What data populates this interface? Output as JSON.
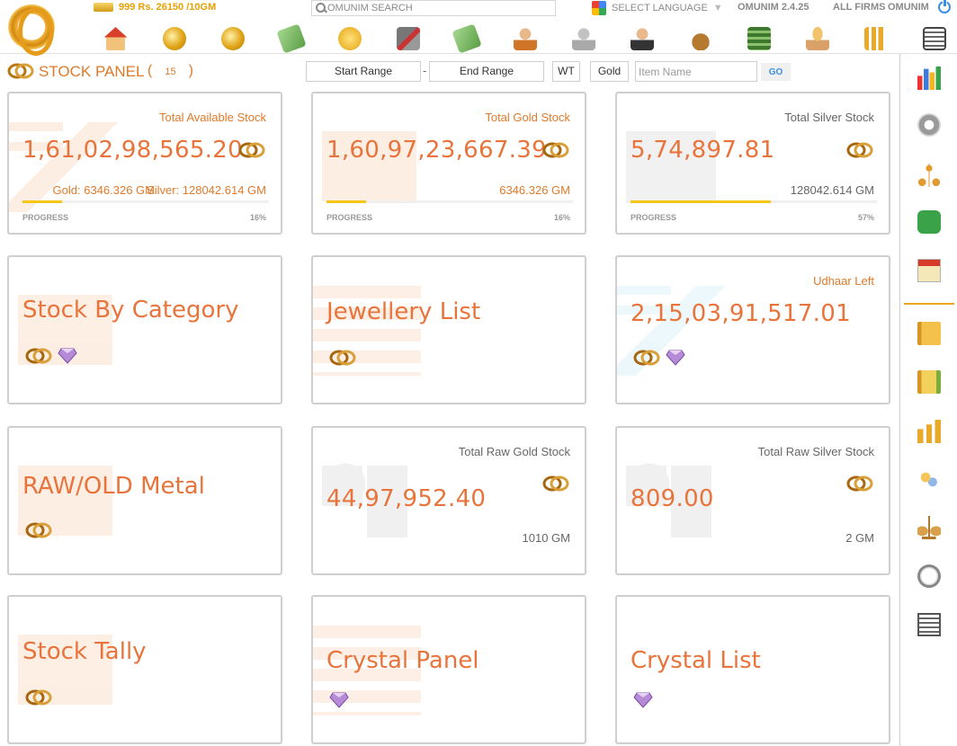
{
  "header": {
    "gold_rate": "999 Rs. 26150 /10GM",
    "search_placeholder": "OMUNIM SEARCH",
    "language": "SELECT LANGUAGE",
    "language_dropdown": "▼",
    "version": "OMUNIM 2.4.25",
    "firms": "ALL FIRMS",
    "user": "OMUNIM"
  },
  "toolbar": {
    "icons": [
      "home-icon",
      "coins-add-icon",
      "coins-icon",
      "money-hand-icon",
      "new-badge-icon",
      "hammer-icon",
      "cash-icon",
      "user-icon",
      "user-add-icon",
      "businessman-icon",
      "money-bag-icon",
      "banknotes-icon",
      "hand-coins-icon",
      "coin-stack-icon",
      "calculator-icon"
    ]
  },
  "sidebar": {
    "icons": [
      "stats-chart-icon",
      "settings-gear-icon",
      "hierarchy-icon",
      "sms-icon",
      "calendar-icon",
      "ledger-icon",
      "ledger-stack-icon",
      "bar-chart-icon",
      "people-icon",
      "scale-icon",
      "stopwatch-icon",
      "calculator-icon"
    ]
  },
  "panel": {
    "title": "STOCK PANEL",
    "count_open": "(",
    "count": "15",
    "count_close": ")",
    "start_range": "Start Range",
    "range_separator": "-",
    "end_range": "End Range",
    "wt": "WT",
    "metal": "Gold",
    "item_name_placeholder": "Item Name",
    "go": "GO"
  },
  "cards": {
    "total": {
      "label": "Total Available Stock",
      "value": "1,61,02,98,565.20",
      "gold_weight": "Gold: 6346.326 GM",
      "silver_weight": "Silver: 128042.614 GM",
      "progress_label": "PROGRESS",
      "progress_pct": "16%",
      "progress": 0.16
    },
    "gold": {
      "label": "Total Gold Stock",
      "value": "1,60,97,23,667.39",
      "weight": "6346.326 GM",
      "progress_label": "PROGRESS",
      "progress_pct": "16%",
      "progress": 0.16
    },
    "silver": {
      "label": "Total Silver Stock",
      "value": "5,74,897.81",
      "weight": "128042.614 GM",
      "progress_label": "PROGRESS",
      "progress_pct": "57%",
      "progress": 0.57
    },
    "category": {
      "title": "Stock By Category"
    },
    "jewellery": {
      "title": "Jewellery List"
    },
    "udhaar": {
      "label": "Udhaar Left",
      "value": "2,15,03,91,517.01"
    },
    "raw": {
      "title": "RAW/OLD Metal"
    },
    "raw_gold": {
      "label": "Total Raw Gold Stock",
      "value": "44,97,952.40",
      "weight": "1010 GM"
    },
    "raw_silver": {
      "label": "Total Raw Silver Stock",
      "value": "809.00",
      "weight": "2 GM"
    },
    "tally": {
      "title": "Stock Tally"
    },
    "crystal_panel": {
      "title": "Crystal Panel"
    },
    "crystal_list": {
      "title": "Crystal List"
    }
  }
}
